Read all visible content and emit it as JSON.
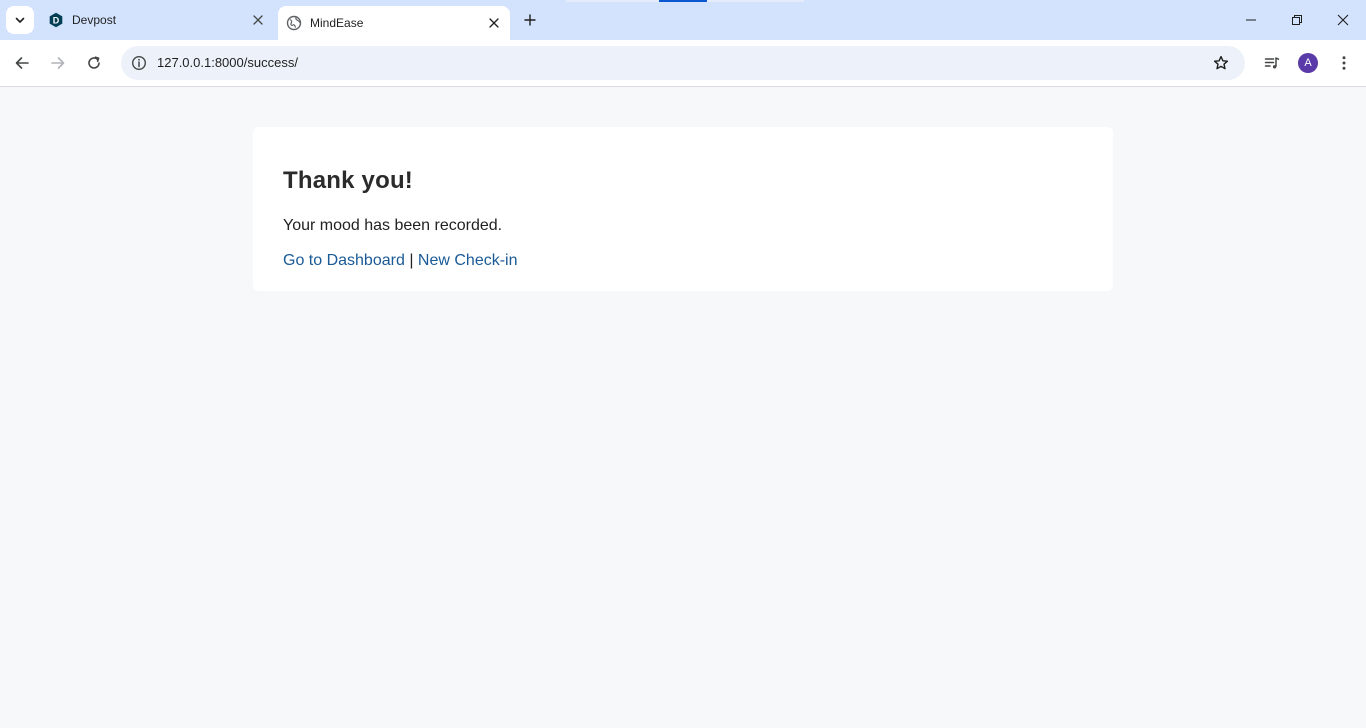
{
  "browser": {
    "tabs": [
      {
        "title": "Devpost",
        "icon": "devpost-favicon",
        "favicon_letter": "D",
        "active": false
      },
      {
        "title": "MindEase",
        "icon": "globe-icon",
        "active": true
      }
    ],
    "url": "127.0.0.1:8000/success/",
    "profile_initial": "A",
    "colors": {
      "tabstrip": "#d3e3fd",
      "omnibox": "#edf2fa",
      "avatar": "#5a3aa8"
    }
  },
  "page": {
    "heading": "Thank you!",
    "message": "Your mood has been recorded.",
    "links": {
      "dashboard": "Go to Dashboard",
      "separator": "|",
      "new_checkin": "New Check-in"
    },
    "colors": {
      "background": "#f6f8fa",
      "link": "#1a5a96"
    }
  }
}
